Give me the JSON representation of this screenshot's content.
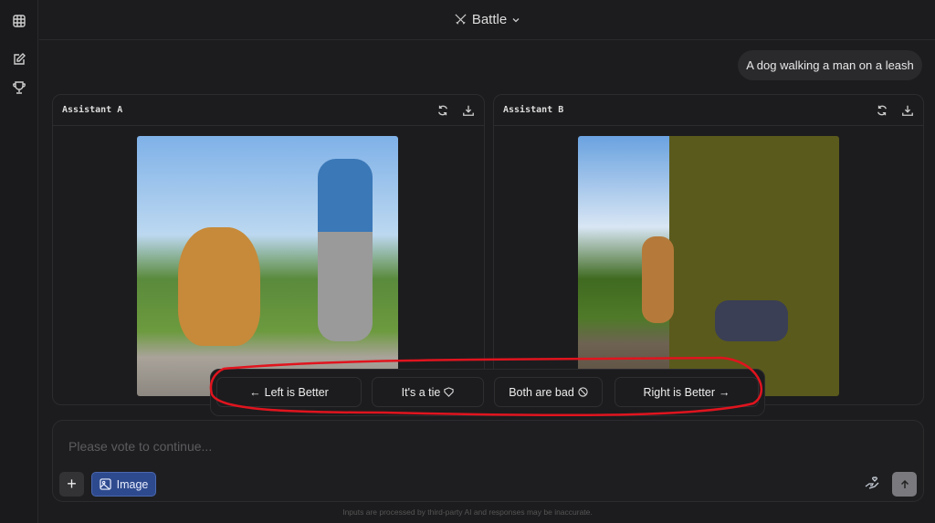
{
  "header": {
    "title": "Battle",
    "icon": "swords-icon"
  },
  "sidebar": {
    "items": [
      {
        "icon": "table-icon"
      },
      {
        "icon": "new-chat-icon"
      },
      {
        "icon": "trophy-icon"
      }
    ]
  },
  "prompt": "A dog walking a man on a leash",
  "panels": [
    {
      "title": "Assistant A"
    },
    {
      "title": "Assistant B"
    }
  ],
  "vote": {
    "left": "Left is Better",
    "tie": "It's a tie",
    "bad": "Both are bad",
    "right": "Right is Better"
  },
  "input": {
    "placeholder": "Please vote to continue...",
    "image_label": "Image"
  },
  "footer": "Inputs are processed by third-party AI and responses may be inaccurate.",
  "colors": {
    "accent": "#2e4a8e",
    "annotation": "#e0141e"
  }
}
